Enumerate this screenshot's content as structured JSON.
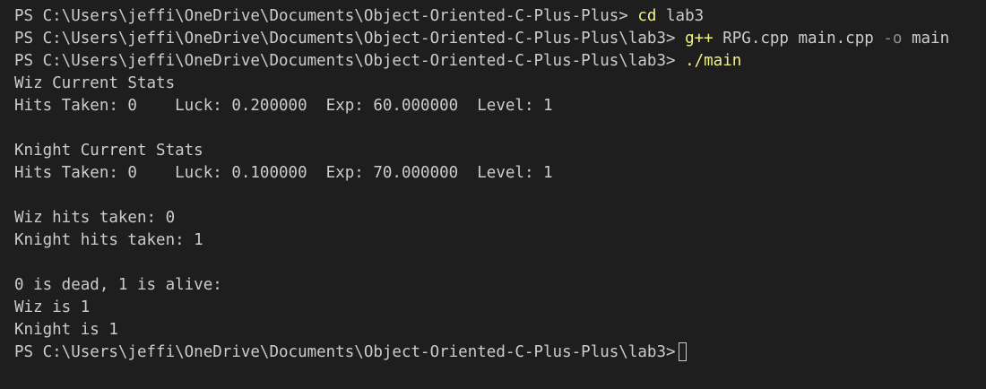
{
  "terminal": {
    "colors": {
      "background": "#1e1e1e",
      "text": "#cccccc",
      "command": "#f1f18a",
      "flag": "#8f8f8f"
    },
    "lines": [
      {
        "prompt": "PS C:\\Users\\jeffi\\OneDrive\\Documents\\Object-Oriented-C-Plus-Plus>",
        "cmd": "cd",
        "args": "lab3"
      },
      {
        "prompt": "PS C:\\Users\\jeffi\\OneDrive\\Documents\\Object-Oriented-C-Plus-Plus\\lab3>",
        "cmd": "g++",
        "args": "RPG.cpp main.cpp",
        "flag": "-o",
        "tail": "main"
      },
      {
        "prompt": "PS C:\\Users\\jeffi\\OneDrive\\Documents\\Object-Oriented-C-Plus-Plus\\lab3>",
        "cmd": "./main"
      }
    ],
    "output": [
      "Wiz Current Stats",
      "Hits Taken: 0    Luck: 0.200000  Exp: 60.000000  Level: 1",
      "",
      "Knight Current Stats",
      "Hits Taken: 0    Luck: 0.100000  Exp: 70.000000  Level: 1",
      "",
      "Wiz hits taken: 0",
      "Knight hits taken: 1",
      "",
      "0 is dead, 1 is alive:",
      "Wiz is 1",
      "Knight is 1"
    ],
    "final_prompt": "PS C:\\Users\\jeffi\\OneDrive\\Documents\\Object-Oriented-C-Plus-Plus\\lab3>"
  }
}
